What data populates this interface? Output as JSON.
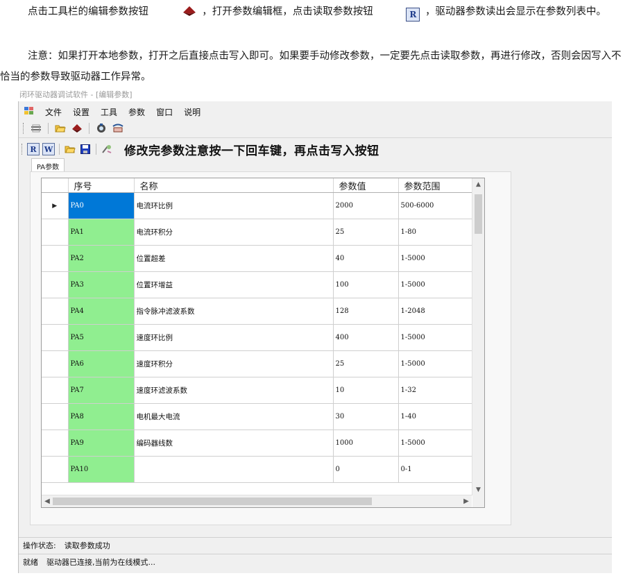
{
  "doc": {
    "p1_a": "点击工具栏的编辑参数按钮",
    "p1_b": "，打开参数编辑框，点击读取参数按钮",
    "p1_c": "，驱动器参数读出会显示在参数列表中。",
    "p2": "注意：如果打开本地参数，打开之后直接点击写入即可。如果要手动修改参数，一定要先点击读取参数，再进行修改，否则会因写入不恰当的参数导致驱动器工作异常。",
    "inline_icon_r": "R"
  },
  "window": {
    "caption": "闭环驱动器调试软件 - [编辑参数]",
    "menu": [
      "文件",
      "设置",
      "工具",
      "参数",
      "窗口",
      "说明"
    ]
  },
  "toolbar2": {
    "read_label": "R",
    "write_label": "W",
    "notice": "修改完参数注意按一下回车键，再点击写入按钮"
  },
  "tab": {
    "label": "PA参数"
  },
  "table": {
    "headers": [
      "序号",
      "名称",
      "参数值",
      "参数范围"
    ],
    "current_row_marker": "▶",
    "rows": [
      {
        "id": "PA0",
        "name": "电流环比例",
        "value": "2000",
        "range": "500-6000"
      },
      {
        "id": "PA1",
        "name": "电流环积分",
        "value": "25",
        "range": "1-80"
      },
      {
        "id": "PA2",
        "name": "位置超差",
        "value": "40",
        "range": "1-5000"
      },
      {
        "id": "PA3",
        "name": "位置环增益",
        "value": "100",
        "range": "1-5000"
      },
      {
        "id": "PA4",
        "name": "指令脉冲滤波系数",
        "value": "128",
        "range": "1-2048"
      },
      {
        "id": "PA5",
        "name": "速度环比例",
        "value": "400",
        "range": "1-5000"
      },
      {
        "id": "PA6",
        "name": "速度环积分",
        "value": "25",
        "range": "1-5000"
      },
      {
        "id": "PA7",
        "name": "速度环滤波系数",
        "value": "10",
        "range": "1-32"
      },
      {
        "id": "PA8",
        "name": "电机最大电流",
        "value": "30",
        "range": "1-40"
      },
      {
        "id": "PA9",
        "name": "编码器线数",
        "value": "1000",
        "range": "1-5000"
      },
      {
        "id": "PA10",
        "name": "",
        "value": "0",
        "range": "0-1"
      }
    ]
  },
  "status": {
    "op_label": "操作状态:",
    "op_value": "读取参数成功",
    "ready_label": "就绪",
    "ready_value": "驱动器已连接,当前为在线模式..."
  },
  "colors": {
    "seq_cell": "#90ee90",
    "selected_cell": "#0078d7"
  }
}
